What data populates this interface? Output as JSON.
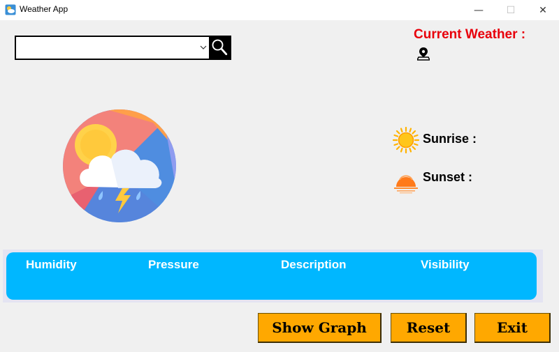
{
  "window": {
    "title": "Weather App",
    "app_icon": "weather-app-icon",
    "controls": {
      "minimize": "—",
      "maximize": "☐",
      "close": "✕"
    }
  },
  "search": {
    "value": "",
    "placeholder": "",
    "dropdown_icon": "chevron-down-icon",
    "button_icon": "magnifier-icon"
  },
  "current_weather": {
    "label": "Current Weather :",
    "label_color": "#e8000b",
    "location_icon": "location-pin-icon"
  },
  "weather_icon": "cloud-sun-thunderstorm-icon",
  "sun": {
    "sunrise_label": "Sunrise :",
    "sunset_label": "Sunset :",
    "sunrise_icon": "sun-icon",
    "sunset_icon": "sunset-icon"
  },
  "info_panel": {
    "background": "#00b7ff",
    "headers": [
      "Humidity",
      "Pressure",
      "Description",
      "Visibility"
    ]
  },
  "buttons": {
    "show_graph": "Show Graph",
    "reset": "Reset",
    "exit": "Exit",
    "color": "#ffa800"
  }
}
